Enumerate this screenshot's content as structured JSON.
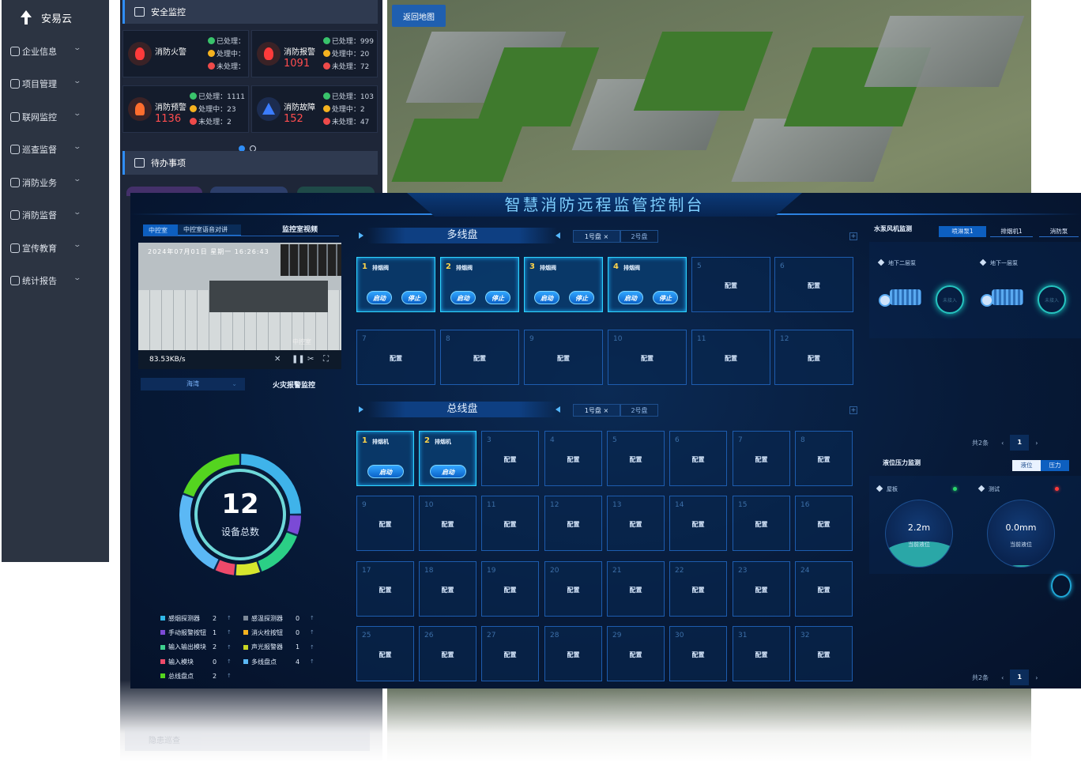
{
  "sidebar": {
    "brand": "安易云",
    "items": [
      {
        "label": "企业信息",
        "icon": "user-icon"
      },
      {
        "label": "项目管理",
        "icon": "shield-icon"
      },
      {
        "label": "联网监控",
        "icon": "monitor-icon"
      },
      {
        "label": "巡查监督",
        "icon": "search-icon"
      },
      {
        "label": "消防业务",
        "icon": "document-icon"
      },
      {
        "label": "消防监督",
        "icon": "shield-check-icon"
      },
      {
        "label": "宣传教育",
        "icon": "speaker-icon"
      },
      {
        "label": "统计报告",
        "icon": "chart-icon"
      }
    ]
  },
  "safety": {
    "title": "安全监控",
    "cards": [
      {
        "title": "消防火警",
        "number": "",
        "lines": [
          "已处理：",
          "处理中：",
          "未处理："
        ]
      },
      {
        "title": "消防报警",
        "number": "1091",
        "lines": [
          "已处理：999",
          "处理中：20",
          "未处理：72"
        ]
      },
      {
        "title": "消防预警",
        "number": "1136",
        "lines": [
          "已处理：1111",
          "处理中：23",
          "未处理：2"
        ]
      },
      {
        "title": "消防故障",
        "number": "152",
        "lines": [
          "已处理：103",
          "处理中：2",
          "未处理：47"
        ]
      }
    ],
    "todo_title": "待办事项",
    "bottom_heading": "隐患巡查"
  },
  "map": {
    "back_button": "返回地图"
  },
  "console": {
    "title": "智慧消防远程监管控制台",
    "left": {
      "tabs": [
        "中控室",
        "中控室语音对讲"
      ],
      "video_label": "监控室视频",
      "timestamp": "2024年07月01日 星期一 16:26:43",
      "camera_caption": "中控室",
      "bitrate": "83.53KB/s",
      "select_value": "海湾",
      "alarm_label": "火灾报警监控",
      "total_number": "12",
      "total_label": "设备总数",
      "legend": [
        {
          "label": "感烟探测器",
          "count": "2",
          "color": "#2fb7e8"
        },
        {
          "label": "感温探测器",
          "count": "0",
          "color": "#7c8898"
        },
        {
          "label": "手动报警按钮",
          "count": "1",
          "color": "#7b4ad6"
        },
        {
          "label": "消火栓按钮",
          "count": "0",
          "color": "#f5b21f"
        },
        {
          "label": "输入输出模块",
          "count": "2",
          "color": "#3dcf8e"
        },
        {
          "label": "声光报警器",
          "count": "1",
          "color": "#c8d623"
        },
        {
          "label": "输入模块",
          "count": "0",
          "color": "#ee4a6a"
        },
        {
          "label": "多线盘点",
          "count": "4",
          "color": "#5bb8f5"
        },
        {
          "label": "总线盘点",
          "count": "2",
          "color": "#54d41f"
        }
      ],
      "arrow": "↑"
    },
    "multiline": {
      "title": "多线盘",
      "tabs": [
        {
          "label": "1号盘",
          "close": "×"
        },
        {
          "label": "2号盘"
        }
      ],
      "plus": "+",
      "active": [
        {
          "num": "1",
          "name": "排烟阀",
          "start": "启动",
          "stop": "停止"
        },
        {
          "num": "2",
          "name": "排烟阀",
          "start": "启动",
          "stop": "停止"
        },
        {
          "num": "3",
          "name": "排烟阀",
          "start": "启动",
          "stop": "停止"
        },
        {
          "num": "4",
          "name": "排烟阀",
          "start": "启动",
          "stop": "停止"
        }
      ],
      "empty": [
        "5",
        "6",
        "7",
        "8",
        "9",
        "10",
        "11",
        "12"
      ],
      "config": "配置"
    },
    "bus": {
      "title": "总线盘",
      "tabs": [
        {
          "label": "1号盘",
          "close": "×"
        },
        {
          "label": "2号盘"
        }
      ],
      "plus": "+",
      "active": [
        {
          "num": "1",
          "name": "排烟机",
          "start": "启动"
        },
        {
          "num": "2",
          "name": "排烟机",
          "start": "启动"
        }
      ],
      "empty": [
        "3",
        "4",
        "5",
        "6",
        "7",
        "8",
        "9",
        "10",
        "11",
        "12",
        "13",
        "14",
        "15",
        "16",
        "17",
        "18",
        "19",
        "20",
        "21",
        "22",
        "23",
        "24",
        "25",
        "26",
        "27",
        "28",
        "29",
        "30",
        "31",
        "32"
      ],
      "config": "配置"
    },
    "right": {
      "pump_title": "水泵风机监测",
      "pump_tabs": [
        "喷淋泵1",
        "排烟机1",
        "消防泵"
      ],
      "pumps": [
        {
          "name": "地下二层泵",
          "status": "未接入"
        },
        {
          "name": "地下一层泵",
          "status": "未接入"
        }
      ],
      "pager_total": "共2条",
      "pager_page": "1",
      "prev": "‹",
      "next": "›",
      "level_title": "液位压力监测",
      "level_tabs": [
        "液位",
        "压力"
      ],
      "gauges": [
        {
          "name": "屋板",
          "value": "2.2m",
          "sub": "当前液位",
          "level": 0.4,
          "dot": "#2bd66b"
        },
        {
          "name": "测试",
          "value": "0.0mm",
          "sub": "当前液位",
          "level": 0.05,
          "dot": "#ff3b3b"
        }
      ],
      "pager2_total": "共2条",
      "pager2_page": "1"
    }
  }
}
